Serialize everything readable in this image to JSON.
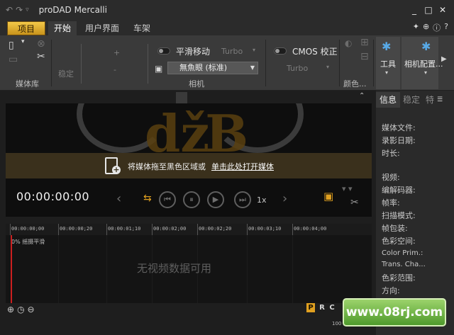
{
  "window": {
    "title": "proDAD Mercalli",
    "buttons": [
      "_",
      "□",
      "✕"
    ]
  },
  "tabs": [
    {
      "label": "项目"
    },
    {
      "label": "开始"
    },
    {
      "label": "用户界面"
    },
    {
      "label": "车架"
    }
  ],
  "ribbon": {
    "media_group": "媒体库",
    "stabilize_label": "稳定",
    "smooth_label": "平滑移动",
    "smooth_mode": "Turbo",
    "lens_combo": "無魚眼 (标准)",
    "camera_group": "相机",
    "cmos_label": "CMOS 校正",
    "cmos_mode": "Turbo",
    "color_group": "颜色...",
    "tools_label": "工具",
    "camera_config_label": "相机配置..."
  },
  "preview": {
    "drop_text": "将媒体拖至黑色区域或",
    "drop_link": "单击此处打开媒体",
    "timecode": "00:00:00:00",
    "speed": "1x"
  },
  "timeline": {
    "ticks": [
      "00:00:00;00",
      "00:00:00;20",
      "00:00:01;10",
      "00:00:02;00",
      "00:00:02;20",
      "00:00:03;10",
      "00:00:04;00"
    ],
    "track_label": "0%  摇摄平滑",
    "no_data": "无视频数据可用",
    "modes": [
      "P",
      "R",
      "C"
    ],
    "bottom_num": "100"
  },
  "info_panel": {
    "tabs": [
      "信息",
      "稳定",
      "特"
    ],
    "labels": [
      "媒体文件:",
      "录影日期:",
      "时长:",
      "视频:",
      "编解码器:",
      "帧率:",
      "扫描模式:",
      "帧包装:",
      "色彩空间:",
      "Color Prim.:",
      "Trans. Cha...",
      "色彩范围:",
      "方向:"
    ]
  },
  "watermark": "www.08rj.com"
}
